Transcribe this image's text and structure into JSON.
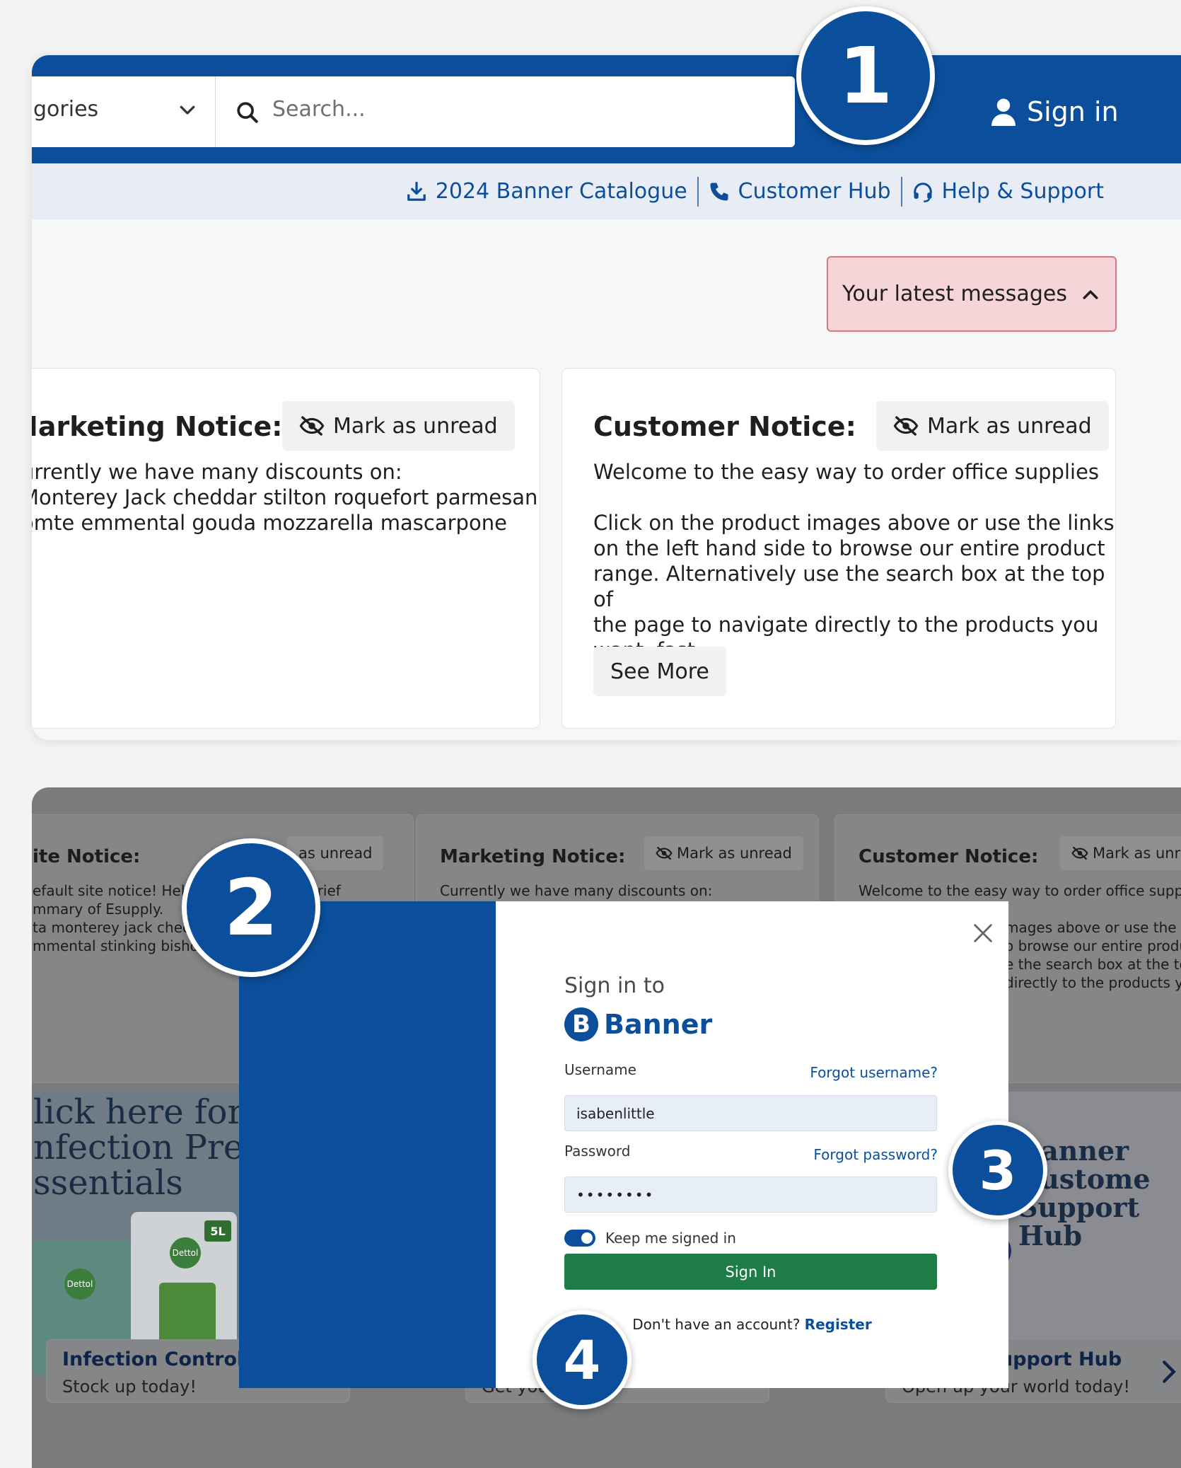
{
  "header": {
    "categories_label": "gories",
    "search_placeholder": "Search...",
    "signin_label": "Sign in"
  },
  "utility_links": [
    {
      "label": "2024 Banner Catalogue",
      "icon": "download-icon"
    },
    {
      "label": "Customer Hub",
      "icon": "phone-icon"
    },
    {
      "label": "Help & Support",
      "icon": "headset-icon"
    }
  ],
  "messages_button": {
    "label": "Your latest messages"
  },
  "notices": {
    "marketing": {
      "title": "Marketing Notice:",
      "mark_label": "Mark as unread",
      "lines": [
        "urrently we have many discounts on:",
        "Monterey Jack cheddar stilton roquefort parmesan",
        "omte emmental gouda mozzarella mascarpone"
      ]
    },
    "customer": {
      "title": "Customer Notice:",
      "mark_label": "Mark as unread",
      "paragraph1": "Welcome to the easy way to order office supplies",
      "paragraph2_lines": [
        "Click on the product images above or use the links",
        "on the left hand side to browse our entire product",
        "range. Alternatively use the search box at the top of",
        "the page to navigate directly to the products you",
        "want, fast."
      ],
      "see_more": "See More"
    }
  },
  "background_page": {
    "site_notice": {
      "title": "ite Notice:",
      "mark_label": "as unread",
      "lines": [
        "efault site notice! Hello",
        "mmary of Esupply.",
        "ta monterey jack ched",
        "mmental stinking bishop"
      ],
      "extra": "brief"
    },
    "marketing_notice": {
      "title": "Marketing Notice:",
      "mark_label": "Mark as unread",
      "line": "Currently we have many discounts on:"
    },
    "customer_notice": {
      "title": "Customer Notice:",
      "mark_label": "Mark as unre",
      "lines": [
        "Welcome to the easy way to order office supplie",
        "mages above or use the lir",
        "o browse our entire produ",
        "e the search box at the to",
        "directly to the products yo"
      ]
    },
    "promo_left": {
      "heading_lines": [
        "lick here for",
        "nfection Prev",
        "ssentials"
      ],
      "brand": "Dettol",
      "volume": "5L",
      "label": "Infection Control",
      "sub": "Stock up today!"
    },
    "promo_middle": {
      "sub": "Get your"
    },
    "promo_right": {
      "heading_lines": [
        "Banner",
        "Custome",
        "Support",
        "Hub"
      ],
      "label": "upport Hub",
      "sub": "Open up your world today!"
    }
  },
  "signin_modal": {
    "title": "Sign in to",
    "brand_letter": "B",
    "brand": "Banner",
    "username_label": "Username",
    "forgot_username": "Forgot username?",
    "username_value": "isabenlittle",
    "password_label": "Password",
    "forgot_password": "Forgot password?",
    "password_value": "••••••••",
    "keep_signed_in": "Keep me signed in",
    "submit_label": "Sign In",
    "no_account": "Don't have an account?",
    "register": "Register"
  },
  "badges": [
    "1",
    "2",
    "3",
    "4"
  ],
  "colors": {
    "brand_blue": "#0b4f9c",
    "messages_pink": "#f6d5d9",
    "signin_green": "#1e7d46"
  }
}
